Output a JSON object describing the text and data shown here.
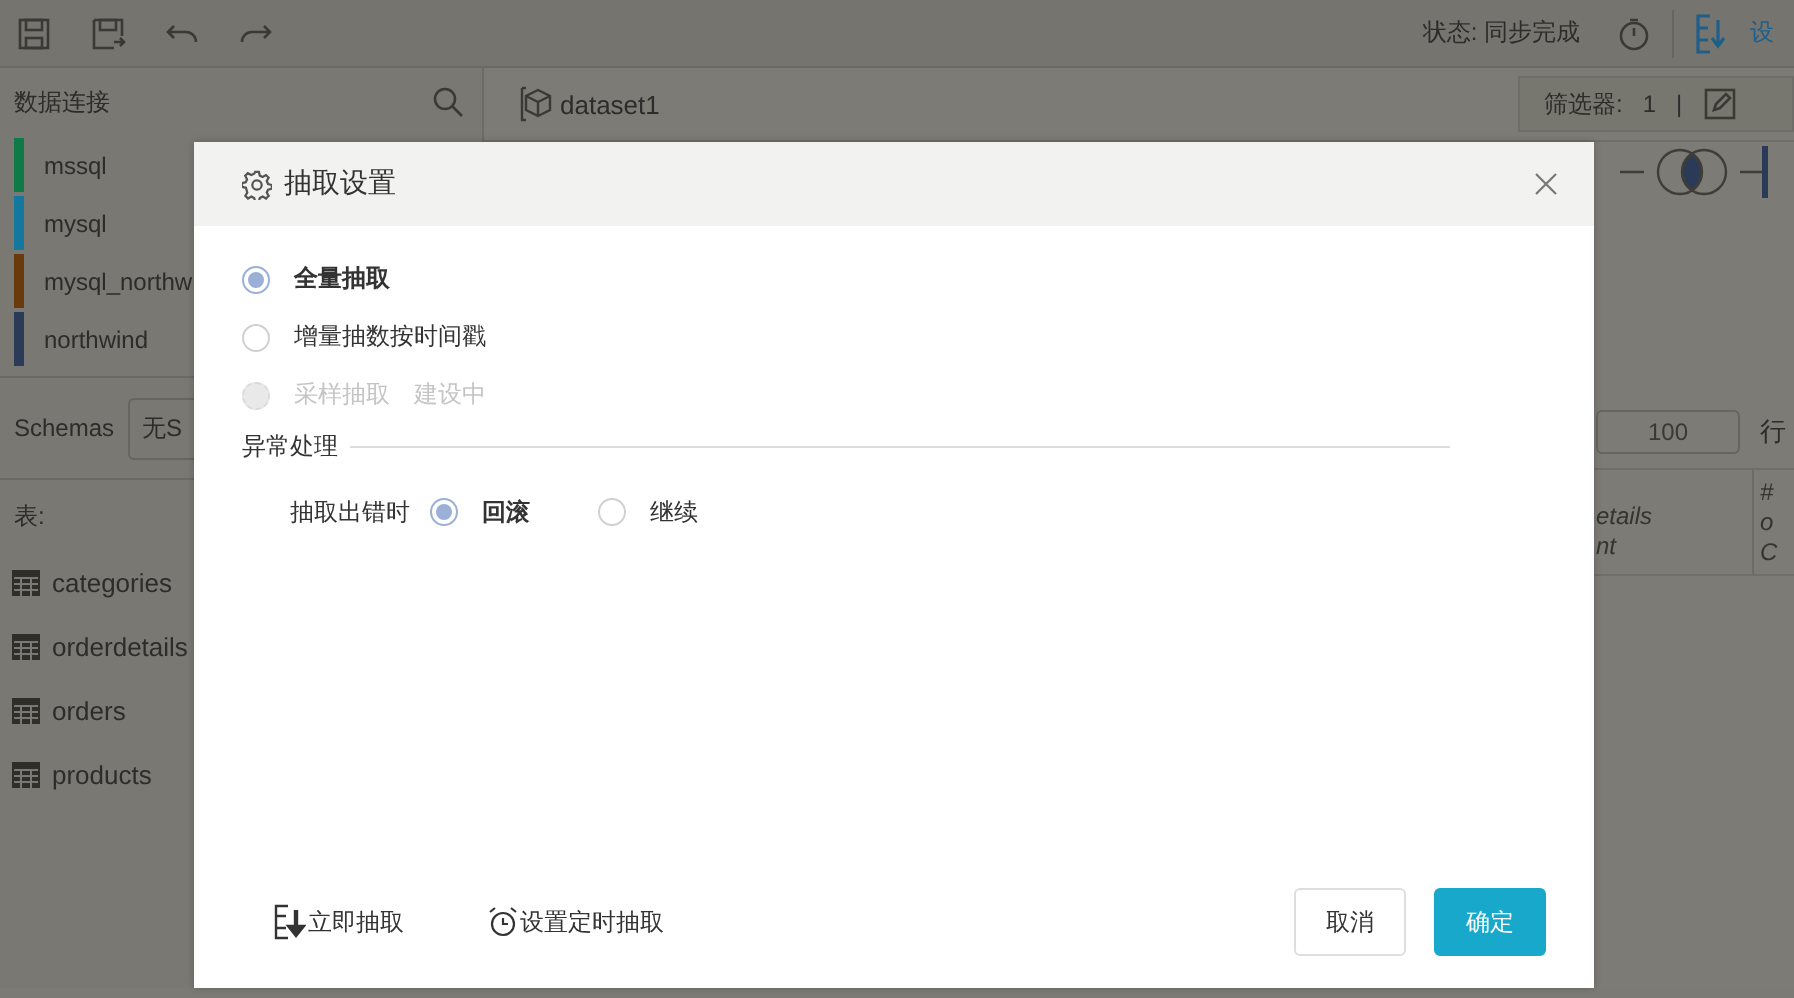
{
  "toolbar": {
    "status": "状态: 同步完成",
    "settings": "设"
  },
  "sidebar": {
    "title": "数据连接",
    "connections": [
      {
        "name": "mssql",
        "color": "#0e7a46"
      },
      {
        "name": "mysql",
        "color": "#12789e"
      },
      {
        "name": "mysql_northw",
        "color": "#6a3a0c"
      },
      {
        "name": "northwind",
        "color": "#2b3a56"
      }
    ],
    "schemas_label": "Schemas",
    "schemas_value": "无S",
    "tables_label": "表:",
    "tables": [
      "categories",
      "orderdetails",
      "orders",
      "products"
    ]
  },
  "main": {
    "dataset": "dataset1",
    "filter": {
      "label": "筛选器:",
      "count": "1",
      "separator": "|"
    },
    "row_limit": "100",
    "row_unit": "行",
    "columns": [
      {
        "name": "etails",
        "type": "nt"
      },
      {
        "mark": "#",
        "name": "o",
        "type": "C"
      }
    ]
  },
  "dialog": {
    "title": "抽取设置",
    "modes": [
      {
        "label": "全量抽取",
        "selected": true,
        "disabled": false
      },
      {
        "label": "增量抽数按时间戳",
        "selected": false,
        "disabled": false
      },
      {
        "label": "采样抽取",
        "note": "建设中",
        "selected": false,
        "disabled": true
      }
    ],
    "section": "异常处理",
    "error_label": "抽取出错时",
    "error_options": [
      {
        "label": "回滚",
        "selected": true
      },
      {
        "label": "继续",
        "selected": false
      }
    ],
    "actions": [
      "立即抽取",
      "设置定时抽取"
    ],
    "cancel": "取消",
    "confirm": "确定"
  }
}
